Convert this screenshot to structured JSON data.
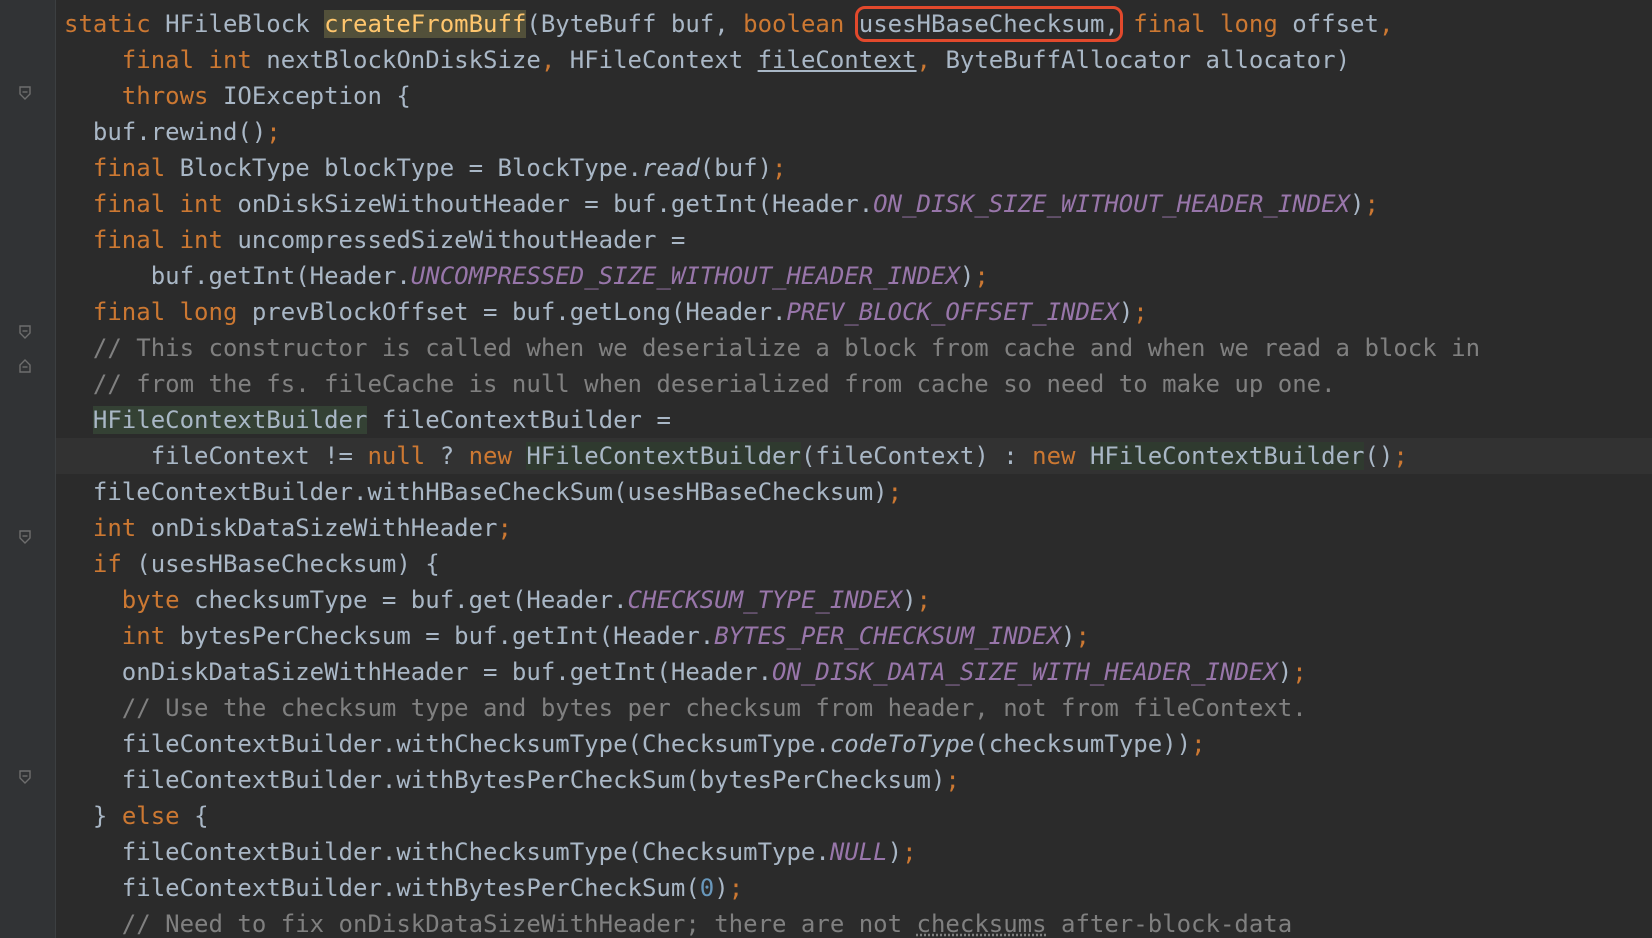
{
  "editor": {
    "background": "#2b2b2b",
    "highlight_color": "#e2492c",
    "fold_markers": [
      "fold-method",
      "fold-comment-start",
      "fold-comment-end",
      "fold-if",
      "fold-else"
    ],
    "lines": [
      {
        "tokens": [
          [
            "kw",
            "static "
          ],
          [
            "",
            "HFileBlock "
          ],
          [
            "fn hl-fn",
            "createFromBuff"
          ],
          [
            "",
            "(ByteBuff buf, "
          ],
          [
            "kw",
            "boolean "
          ],
          [
            "boxed",
            "usesHBaseChecksum,"
          ],
          [
            "kw",
            " final long "
          ],
          [
            "",
            "offset"
          ],
          [
            "kw",
            ","
          ]
        ]
      },
      {
        "tokens": [
          [
            "kw",
            "  final int "
          ],
          [
            "",
            "nextBlockOnDiskSize"
          ],
          [
            "kw",
            ", "
          ],
          [
            "",
            "HFileContext "
          ],
          [
            "ul",
            "fileContext"
          ],
          [
            "kw",
            ", "
          ],
          [
            "",
            "ByteBuffAllocator allocator)"
          ]
        ]
      },
      {
        "tokens": [
          [
            "kw",
            "  throws "
          ],
          [
            "",
            "IOException {"
          ]
        ]
      },
      {
        "tokens": [
          [
            "",
            "buf.rewind()"
          ],
          [
            "kw",
            ";"
          ]
        ]
      },
      {
        "tokens": [
          [
            "kw",
            "final "
          ],
          [
            "",
            "BlockType blockType = BlockType."
          ],
          [
            "it",
            "read"
          ],
          [
            "",
            "(buf)"
          ],
          [
            "kw",
            ";"
          ]
        ]
      },
      {
        "tokens": [
          [
            "kw",
            "final int "
          ],
          [
            "",
            "onDiskSizeWithoutHeader = buf.getInt(Header."
          ],
          [
            "cst",
            "ON_DISK_SIZE_WITHOUT_HEADER_INDEX"
          ],
          [
            "",
            ")"
          ],
          [
            "kw",
            ";"
          ]
        ]
      },
      {
        "tokens": [
          [
            "kw",
            "final int "
          ],
          [
            "",
            "uncompressedSizeWithoutHeader ="
          ]
        ]
      },
      {
        "tokens": [
          [
            "",
            "    buf.getInt(Header."
          ],
          [
            "cst",
            "UNCOMPRESSED_SIZE_WITHOUT_HEADER_INDEX"
          ],
          [
            "",
            ")"
          ],
          [
            "kw",
            ";"
          ]
        ]
      },
      {
        "tokens": [
          [
            "kw",
            "final long "
          ],
          [
            "",
            "prevBlockOffset = buf.getLong(Header."
          ],
          [
            "cst",
            "PREV_BLOCK_OFFSET_INDEX"
          ],
          [
            "",
            ")"
          ],
          [
            "kw",
            ";"
          ]
        ]
      },
      {
        "tokens": [
          [
            "cmt",
            "// This constructor is called when we deserialize a block from cache and when we read a block in"
          ]
        ]
      },
      {
        "tokens": [
          [
            "cmt",
            "// from the fs. fileCache is null when deserialized from cache so need to make up one."
          ]
        ]
      },
      {
        "tokens": [
          [
            "hl-type",
            "HFileContextBuilder"
          ],
          [
            "",
            " fileContextBuilder ="
          ]
        ]
      },
      {
        "tokens": [
          [
            "",
            "    fileContext != "
          ],
          [
            "kw",
            "null "
          ],
          [
            "",
            "? "
          ],
          [
            "kw",
            "new "
          ],
          [
            "hl-type2",
            "HFileContextBuilder"
          ],
          [
            "",
            "(fileContext) : "
          ],
          [
            "kw",
            "new "
          ],
          [
            "hl-type2",
            "HFileContextBuilder"
          ],
          [
            "",
            "()"
          ],
          [
            "kw",
            ";"
          ]
        ]
      },
      {
        "tokens": [
          [
            "",
            "fileContextBuilder.withHBaseCheckSum(usesHBaseChecksum)"
          ],
          [
            "kw",
            ";"
          ]
        ]
      },
      {
        "tokens": [
          [
            "kw",
            "int "
          ],
          [
            "",
            "onDiskDataSizeWithHeader"
          ],
          [
            "kw",
            ";"
          ]
        ]
      },
      {
        "tokens": [
          [
            "kw",
            "if "
          ],
          [
            "",
            "(usesHBaseChecksum) {"
          ]
        ]
      },
      {
        "tokens": [
          [
            "kw",
            "  byte "
          ],
          [
            "",
            "checksumType = buf.get(Header."
          ],
          [
            "cst",
            "CHECKSUM_TYPE_INDEX"
          ],
          [
            "",
            ")"
          ],
          [
            "kw",
            ";"
          ]
        ]
      },
      {
        "tokens": [
          [
            "kw",
            "  int "
          ],
          [
            "",
            "bytesPerChecksum = buf.getInt(Header."
          ],
          [
            "cst",
            "BYTES_PER_CHECKSUM_INDEX"
          ],
          [
            "",
            ")"
          ],
          [
            "kw",
            ";"
          ]
        ]
      },
      {
        "tokens": [
          [
            "",
            "  onDiskDataSizeWithHeader = buf.getInt(Header."
          ],
          [
            "cst",
            "ON_DISK_DATA_SIZE_WITH_HEADER_INDEX"
          ],
          [
            "",
            ")"
          ],
          [
            "kw",
            ";"
          ]
        ]
      },
      {
        "tokens": [
          [
            "cmt",
            "  // Use the checksum type and bytes per checksum from header, not from fileContext."
          ]
        ]
      },
      {
        "tokens": [
          [
            "",
            "  fileContextBuilder.withChecksumType(ChecksumType."
          ],
          [
            "it",
            "codeToType"
          ],
          [
            "",
            "(checksumType))"
          ],
          [
            "kw",
            ";"
          ]
        ]
      },
      {
        "tokens": [
          [
            "",
            "  fileContextBuilder.withBytesPerCheckSum(bytesPerChecksum)"
          ],
          [
            "kw",
            ";"
          ]
        ]
      },
      {
        "tokens": [
          [
            "",
            "} "
          ],
          [
            "kw",
            "else "
          ],
          [
            "",
            "{"
          ]
        ]
      },
      {
        "tokens": [
          [
            "",
            "  fileContextBuilder.withChecksumType(ChecksumType."
          ],
          [
            "cst",
            "NULL"
          ],
          [
            "",
            ")"
          ],
          [
            "kw",
            ";"
          ]
        ]
      },
      {
        "tokens": [
          [
            "",
            "  fileContextBuilder.withBytesPerCheckSum("
          ],
          [
            "num",
            "0"
          ],
          [
            "",
            ")"
          ],
          [
            "kw",
            ";"
          ]
        ]
      },
      {
        "tokens": [
          [
            "cmt",
            "  // Need to fix onDiskDataSizeWithHeader; there are not "
          ],
          [
            "cmt typo",
            "checksums"
          ],
          [
            "cmt",
            " after-block-data"
          ]
        ]
      }
    ]
  }
}
